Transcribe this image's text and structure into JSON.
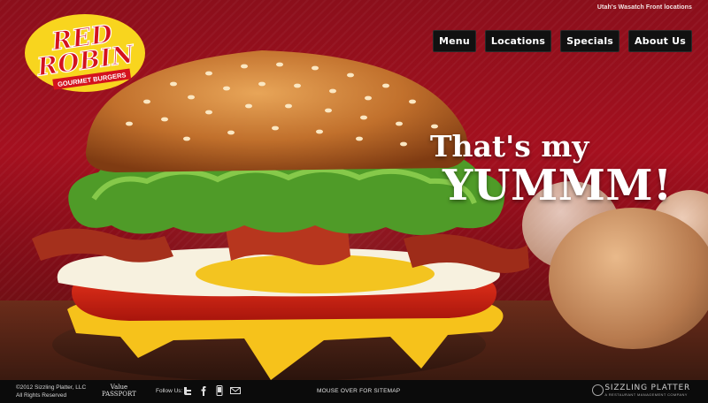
{
  "header": {
    "site_tag": "Utah's Wasatch Front locations",
    "logo": {
      "line1": "RED",
      "line2": "ROBIN",
      "ribbon": "GOURMET BURGERS"
    }
  },
  "nav": [
    {
      "label": "Menu"
    },
    {
      "label": "Locations"
    },
    {
      "label": "Specials"
    },
    {
      "label": "About Us"
    }
  ],
  "hero": {
    "headline_line1": "That's my",
    "headline_line2": "YUMMM!"
  },
  "footer": {
    "copyright": "©2012 Sizzling Platter, LLC",
    "rights": "All Rights Reserved",
    "passport_line1": "Value",
    "passport_line2": "PASSPORT",
    "follow_label": "Follow Us:",
    "sitemap": "MOUSE OVER FOR SITEMAP",
    "company_name": "SIZZLING PLATTER",
    "company_tagline": "A RESTAURANT MANAGEMENT COMPANY"
  },
  "social_icons": [
    "twitter-icon",
    "facebook-icon",
    "mobile-icon",
    "email-icon"
  ]
}
